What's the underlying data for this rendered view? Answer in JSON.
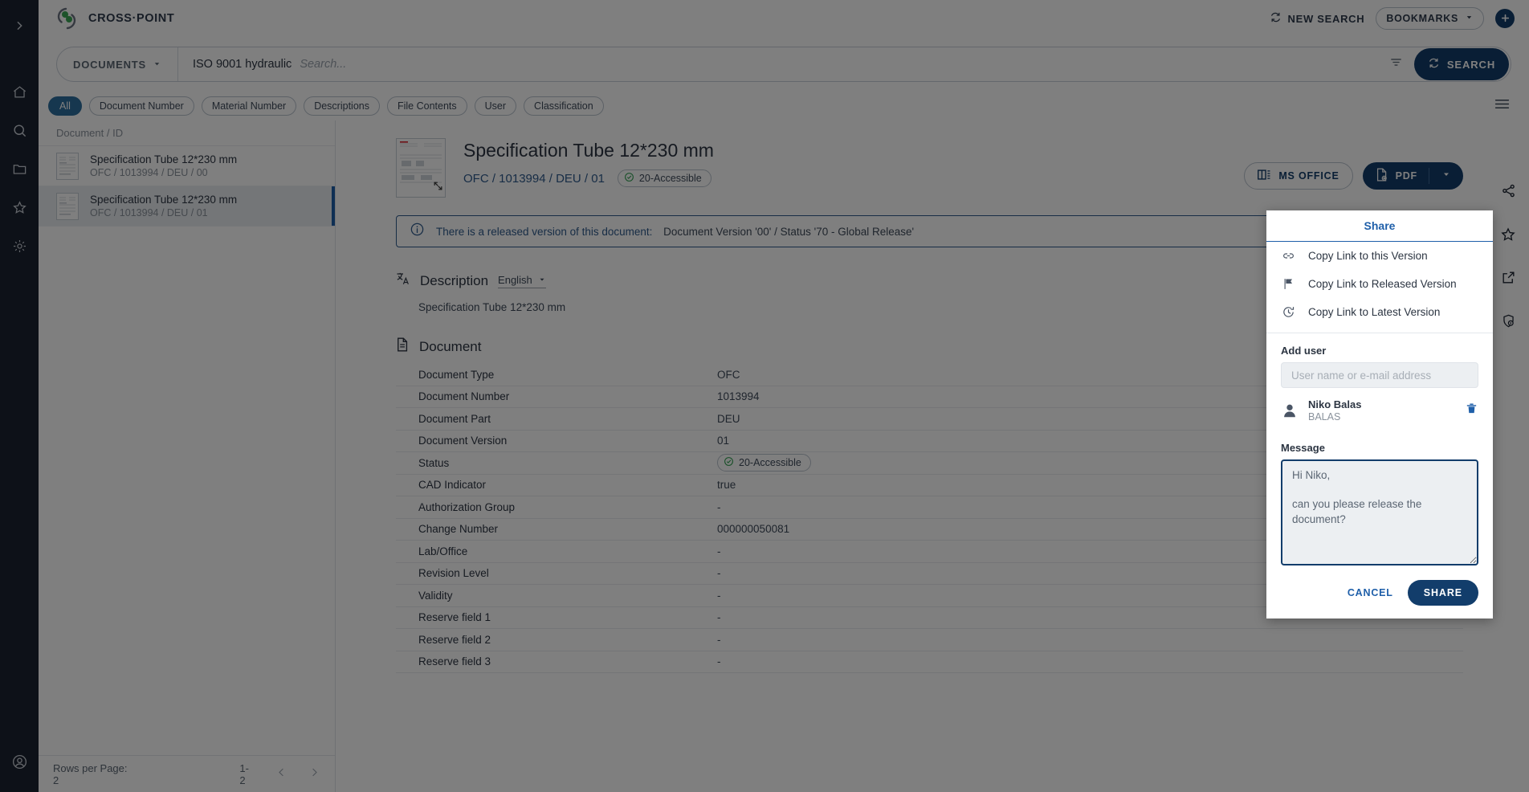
{
  "app": {
    "brand": "CROSS·POINT",
    "logo_icon": "cross-point-logo-icon"
  },
  "left_rail": {
    "expand_label": "chevron-right-icon",
    "items": [
      {
        "icon": "home-icon",
        "name": "home"
      },
      {
        "icon": "search-icon",
        "name": "search"
      },
      {
        "icon": "folder-icon",
        "name": "folders"
      },
      {
        "icon": "star-icon",
        "name": "favorites"
      },
      {
        "icon": "gear-icon",
        "name": "settings"
      }
    ],
    "bottom": {
      "icon": "account-circle-icon",
      "name": "account"
    }
  },
  "header": {
    "new_search_label": "NEW SEARCH",
    "new_search_icon": "refresh-icon",
    "bookmarks_label": "BOOKMARKS",
    "bookmarks_caret": "chevron-down-icon",
    "add_label": "+",
    "add_icon": "plus-circle-icon"
  },
  "search": {
    "scope_label": "DOCUMENTS",
    "scope_caret": "chevron-down-icon",
    "value": "ISO 9001 hydraulic",
    "placeholder": "Search...",
    "filter_icon": "filter-icon",
    "button_label": "SEARCH",
    "button_icon": "refresh-icon"
  },
  "chips": {
    "items": [
      {
        "label": "All",
        "active": true
      },
      {
        "label": "Document Number",
        "active": false
      },
      {
        "label": "Material Number",
        "active": false
      },
      {
        "label": "Descriptions",
        "active": false
      },
      {
        "label": "File Contents",
        "active": false
      },
      {
        "label": "User",
        "active": false
      },
      {
        "label": "Classification",
        "active": false
      }
    ],
    "menu_icon": "hamburger-menu-icon"
  },
  "results": {
    "column_header": "Document / ID",
    "items": [
      {
        "title": "Specification Tube 12*230 mm",
        "subtitle": "OFC / 1013994 / DEU / 00",
        "selected": false
      },
      {
        "title": "Specification Tube 12*230 mm",
        "subtitle": "OFC / 1013994 / DEU / 01",
        "selected": true
      }
    ],
    "pager": {
      "rows_per_page": "Rows per Page: 2",
      "range": "1-2",
      "prev_icon": "chevron-left-icon",
      "next_icon": "chevron-right-icon"
    }
  },
  "document": {
    "title": "Specification Tube 12*230 mm",
    "path": "OFC / 1013994 / DEU / 01",
    "status_badge": "20-Accessible",
    "status_icon": "check-circle-icon",
    "preview_icon": "expand-icon",
    "actions": {
      "ms_office_label": "MS OFFICE",
      "ms_office_icon": "ms-office-icon",
      "pdf_label": "PDF",
      "pdf_icon": "pdf-preview-icon",
      "pdf_caret": "chevron-down-icon"
    },
    "banner": {
      "icon": "info-circle-icon",
      "lead": "There is a released version of this document:",
      "detail": "Document Version '00'  /  Status '70 - Global Release'"
    },
    "description_section": {
      "icon": "translate-icon",
      "title": "Description",
      "language": "English",
      "language_caret": "chevron-down-icon",
      "collapse_icon": "chevron-up-icon",
      "text": "Specification Tube 12*230 mm"
    },
    "document_section": {
      "icon": "document-icon",
      "title": "Document",
      "collapse_icon": "chevron-up-icon",
      "rows": [
        {
          "key": "Document Type",
          "value": "OFC"
        },
        {
          "key": "Document Number",
          "value": "1013994"
        },
        {
          "key": "Document Part",
          "value": "DEU"
        },
        {
          "key": "Document Version",
          "value": "01"
        },
        {
          "key": "Status",
          "value": "20-Accessible",
          "badge": true
        },
        {
          "key": "CAD Indicator",
          "value": "true"
        },
        {
          "key": "Authorization Group",
          "value": "-"
        },
        {
          "key": "Change Number",
          "value": "000000050081"
        },
        {
          "key": "Lab/Office",
          "value": "-"
        },
        {
          "key": "Revision Level",
          "value": "-"
        },
        {
          "key": "Validity",
          "value": "-"
        },
        {
          "key": "Reserve field 1",
          "value": "-"
        },
        {
          "key": "Reserve field 2",
          "value": "-"
        },
        {
          "key": "Reserve field 3",
          "value": "-"
        }
      ]
    }
  },
  "right_rail": {
    "items": [
      {
        "icon": "share-icon",
        "name": "share"
      },
      {
        "icon": "star-outline-icon",
        "name": "bookmark"
      },
      {
        "icon": "open-external-icon",
        "name": "open-in-new"
      },
      {
        "icon": "shield-info-icon",
        "name": "security-info"
      }
    ]
  },
  "share_popover": {
    "title": "Share",
    "links": [
      {
        "label": "Copy Link to this Version",
        "icon": "link-icon"
      },
      {
        "label": "Copy Link to Released Version",
        "icon": "flag-icon"
      },
      {
        "label": "Copy Link to Latest Version",
        "icon": "history-clock-icon"
      }
    ],
    "add_user_label": "Add user",
    "add_user_placeholder": "User name or e-mail address",
    "add_user_value": "",
    "user": {
      "avatar_icon": "person-avatar-icon",
      "name": "Niko Balas",
      "id": "BALAS",
      "delete_icon": "trash-icon"
    },
    "message_label": "Message",
    "message_value": "Hi Niko,\n\ncan you please release the document?",
    "cancel_label": "CANCEL",
    "share_label": "SHARE"
  },
  "colors": {
    "brand_dark": "#123d6b",
    "accent_blue": "#1f5fa9",
    "link_blue": "#2f5a8c",
    "chip_active": "#2d6f9e",
    "rail_dark": "#1b2330",
    "status_green": "#2e9e4f"
  }
}
